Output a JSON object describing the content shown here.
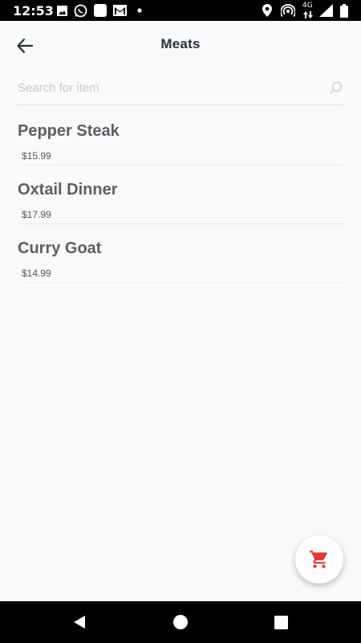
{
  "status_bar": {
    "time": "12:53",
    "network_label": "4G"
  },
  "header": {
    "title": "Meats"
  },
  "search": {
    "placeholder": "Search for item",
    "value": ""
  },
  "items": [
    {
      "name": "Pepper Steak",
      "price": "$15.99"
    },
    {
      "name": "Oxtail Dinner",
      "price": "$17.99"
    },
    {
      "name": "Curry Goat",
      "price": "$14.99"
    }
  ],
  "colors": {
    "cart_icon": "#e53935",
    "title": "#263238",
    "item_name": "#5b5e63"
  }
}
